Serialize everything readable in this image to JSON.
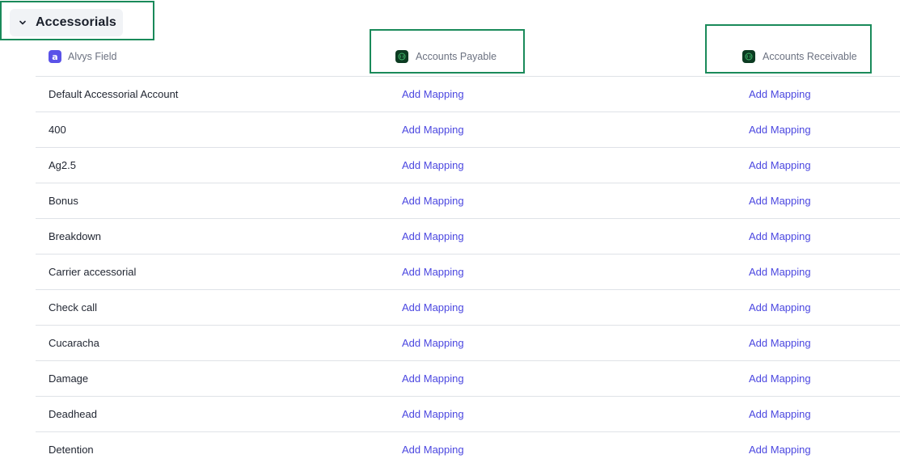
{
  "section": {
    "title": "Accessorials"
  },
  "columns": {
    "alvys_field": "Alvys Field",
    "accounts_payable": "Accounts Payable",
    "accounts_receivable": "Accounts Receivable"
  },
  "rows": [
    {
      "field": "Default Accessorial Account",
      "ap": "Add Mapping",
      "ar": "Add Mapping"
    },
    {
      "field": "400",
      "ap": "Add Mapping",
      "ar": "Add Mapping"
    },
    {
      "field": "Ag2.5",
      "ap": "Add Mapping",
      "ar": "Add Mapping"
    },
    {
      "field": "Bonus",
      "ap": "Add Mapping",
      "ar": "Add Mapping"
    },
    {
      "field": "Breakdown",
      "ap": "Add Mapping",
      "ar": "Add Mapping"
    },
    {
      "field": "Carrier accessorial",
      "ap": "Add Mapping",
      "ar": "Add Mapping"
    },
    {
      "field": "Check call",
      "ap": "Add Mapping",
      "ar": "Add Mapping"
    },
    {
      "field": "Cucaracha",
      "ap": "Add Mapping",
      "ar": "Add Mapping"
    },
    {
      "field": "Damage",
      "ap": "Add Mapping",
      "ar": "Add Mapping"
    },
    {
      "field": "Deadhead",
      "ap": "Add Mapping",
      "ar": "Add Mapping"
    },
    {
      "field": "Detention",
      "ap": "Add Mapping",
      "ar": "Add Mapping"
    }
  ],
  "icons": {
    "collapse": "chevron-down-icon",
    "alvys": "alvys-logo-icon",
    "quickbooks": "quickbooks-logo-icon"
  },
  "colors": {
    "link": "#4b47e0",
    "highlight": "#1a8a5a",
    "alvys_brand": "#5a52e8",
    "quickbooks_brand": "#0c3b22"
  }
}
